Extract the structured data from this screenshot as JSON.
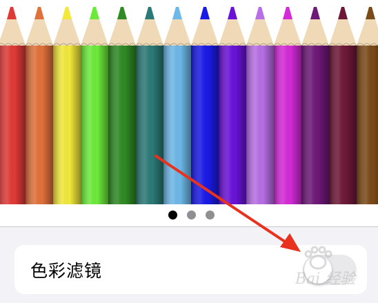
{
  "carousel": {
    "pencil_colors": [
      "#e03a36",
      "#e0713a",
      "#f2e83a",
      "#6cea3a",
      "#2f8a24",
      "#2b7a78",
      "#6db8e8",
      "#1a1ae8",
      "#6a12d8",
      "#b86ee6",
      "#d42ad8",
      "#6e1878",
      "#6e1838",
      "#7a4a18"
    ],
    "page_count": 3,
    "active_page": 1
  },
  "settings": {
    "color_filter_label": "色彩滤镜",
    "color_filter_enabled": false
  },
  "watermark": {
    "text": "Bai 经验"
  },
  "annotation": {
    "arrow_color": "#e8321e"
  }
}
